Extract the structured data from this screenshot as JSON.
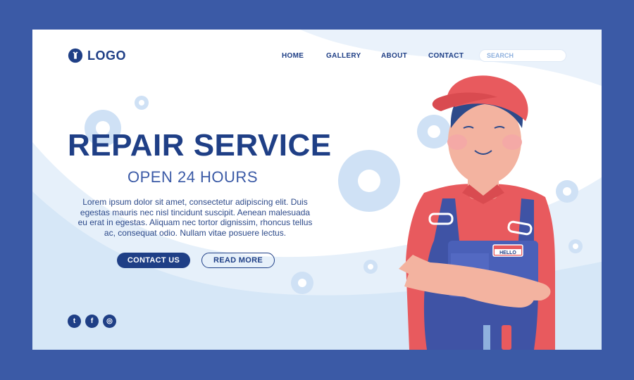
{
  "nav": {
    "logo_text": "LOGO",
    "items": [
      {
        "label": "HOME"
      },
      {
        "label": "GALLERY"
      },
      {
        "label": "ABOUT"
      },
      {
        "label": "CONTACT"
      }
    ],
    "search_placeholder": "SEARCH"
  },
  "hero": {
    "title": "REPAIR SERVICE",
    "subtitle": "OPEN 24 HOURS",
    "body": "Lorem ipsum dolor sit amet, consectetur adipiscing elit. Duis egestas mauris nec nisl tincidunt suscipit. Aenean malesuada eu erat in egestas. Aliquam nec tortor dignissim, rhoncus tellus ac, consequat odio. Nullam vitae posuere lectus.",
    "primary_button": "CONTACT US",
    "secondary_button": "READ MORE"
  },
  "illustration": {
    "badge_text": "HELLO"
  },
  "social": {
    "icons": [
      "twitter-icon",
      "facebook-icon",
      "instagram-icon"
    ],
    "glyphs": [
      "t",
      "f",
      "◎"
    ]
  },
  "colors": {
    "frame": "#3b5aa6",
    "primary": "#1f3f86",
    "accent": "#3b5aa6",
    "light_bg": "#dbeaf8",
    "cap_red": "#e85a5e"
  }
}
